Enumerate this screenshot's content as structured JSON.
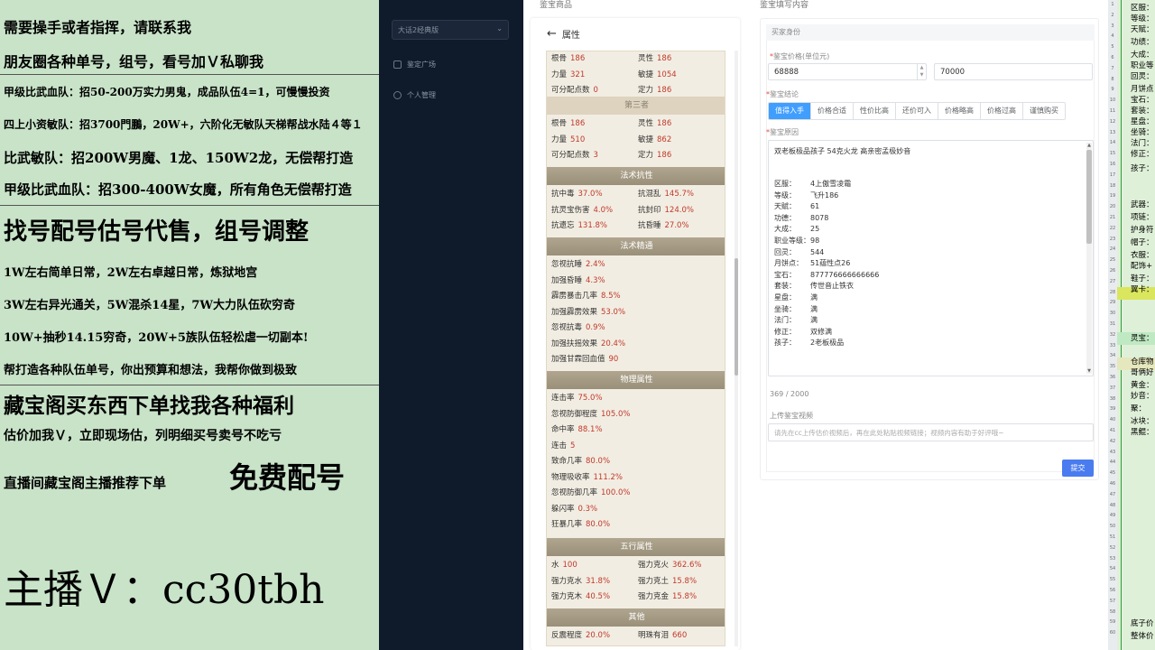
{
  "overlay": {
    "lines": [
      "需要操手或者指挥，请联系我",
      "朋友圈各种单号，组号，看号加Ｖ私聊我",
      "甲级比武血队：招50-200万实力男鬼，成品队伍4=1，可慢慢投资",
      "四上小资敏队：招3700門鵬，20W+，六阶化无敏队天梯帮战水陆４等１",
      "比武敏队：招200W男魔、1龙、150W2龙，无偿帮打造",
      "甲级比武血队：招300-400W女魔，所有角色无偿帮打造",
      "找号配号估号代售，组号调整",
      "1W左右简单日常，2W左右卓越日常，炼狱地宫",
      "3W左右异光通关，5W混杀14星，7W大力队伍砍穷奇",
      "10W+抽秒14.15穷奇，20W+5族队伍轻松虐一切副本!",
      "帮打造各种队伍单号，你出预算和想法，我帮你做到极致",
      "藏宝阁买东西下单找我各种福利",
      "估价加我Ｖ，立即现场估，列明细买号卖号不吃亏",
      "直播间藏宝阁主播推荐下单",
      "免费配号",
      "主播Ｖ：cc30tbh"
    ]
  },
  "appnav": {
    "select_value": "大话2经典版",
    "items": [
      "鉴定广场",
      "个人管理"
    ]
  },
  "main": {
    "left_title": "鉴宝商品",
    "right_title": "鉴宝填写内容",
    "attr_back_label": "属性",
    "blocks": [
      {
        "header": "",
        "rows": [
          {
            "k1": "根骨",
            "v1": "186",
            "k2": "灵性",
            "v2": "186"
          },
          {
            "k1": "力量",
            "v1": "321",
            "k2": "敏捷",
            "v2": "1054"
          },
          {
            "k1": "可分配点数",
            "v1": "0",
            "k2": "定力",
            "v2": "186"
          }
        ]
      },
      {
        "header": "第三者",
        "rows": [
          {
            "k1": "根骨",
            "v1": "186",
            "k2": "灵性",
            "v2": "186"
          },
          {
            "k1": "力量",
            "v1": "510",
            "k2": "敏捷",
            "v2": "862"
          },
          {
            "k1": "可分配点数",
            "v1": "3",
            "k2": "定力",
            "v2": "186"
          }
        ]
      },
      {
        "header": "法术抗性",
        "rows": [
          {
            "k1": "抗中毒",
            "v1": "37.0%",
            "k2": "抗混乱",
            "v2": "145.7%"
          },
          {
            "k1": "抗灵宝伤害",
            "v1": "4.0%",
            "k2": "抗封印",
            "v2": "124.0%"
          },
          {
            "k1": "抗遗忘",
            "v1": "131.8%",
            "k2": "抗昏睡",
            "v2": "27.0%"
          }
        ]
      },
      {
        "header": "法术精通",
        "rows": [
          {
            "k1": "忽视抗睡",
            "v1": "2.4%"
          },
          {
            "k1": "加强昏睡",
            "v1": "4.3%"
          },
          {
            "k1": "霹雳暴击几率",
            "v1": "8.5%"
          },
          {
            "k1": "加强霹雳效果",
            "v1": "53.0%"
          },
          {
            "k1": "忽视抗毒",
            "v1": "0.9%"
          },
          {
            "k1": "加强扶摇效果",
            "v1": "20.4%"
          },
          {
            "k1": "加强甘霖回血值",
            "v1": "90"
          }
        ]
      },
      {
        "header": "物理属性",
        "rows": [
          {
            "k1": "连击率",
            "v1": "75.0%"
          },
          {
            "k1": "忽视防御程度",
            "v1": "105.0%"
          },
          {
            "k1": "命中率",
            "v1": "88.1%"
          },
          {
            "k1": "连击",
            "v1": "5"
          },
          {
            "k1": "致命几率",
            "v1": "80.0%"
          },
          {
            "k1": "物理吸收率",
            "v1": "111.2%"
          },
          {
            "k1": "忽视防御几率",
            "v1": "100.0%"
          },
          {
            "k1": "躲闪率",
            "v1": "0.3%"
          },
          {
            "k1": "狂暴几率",
            "v1": "80.0%"
          }
        ]
      },
      {
        "header": "五行属性",
        "rows": [
          {
            "k1": "水",
            "v1": "100",
            "k2": "强力克火",
            "v2": "362.6%"
          },
          {
            "k1": "强力克水",
            "v1": "31.8%",
            "k2": "强力克土",
            "v2": "15.8%"
          },
          {
            "k1": "强力克木",
            "v1": "40.5%",
            "k2": "强力克金",
            "v2": "15.8%"
          }
        ]
      },
      {
        "header": "其他",
        "rows": [
          {
            "k1": "反震程度",
            "v1": "20.0%",
            "k2": "明珠有泪",
            "v2": "660"
          }
        ]
      }
    ]
  },
  "form": {
    "section_title": "买家身份",
    "price_label": "鉴宝价格(单位元)",
    "price_min": "68888",
    "price_max": "70000",
    "result_label": "鉴宝结论",
    "tabs": [
      "值得入手",
      "价格合适",
      "性价比高",
      "还价可入",
      "价格略高",
      "价格过高",
      "谨慎购买"
    ],
    "reason_label": "鉴宝原因",
    "reason_title": "双老板极品孩子 54克火龙 高亲密孟极妙音",
    "reason_rows": [
      {
        "k": "区服：",
        "v": "4上傲雪凌霜"
      },
      {
        "k": "等级：",
        "v": "飞升186"
      },
      {
        "k": "天赋：",
        "v": "61"
      },
      {
        "k": "功德：",
        "v": "8078"
      },
      {
        "k": "大成：",
        "v": "25"
      },
      {
        "k": "职业等级：",
        "v": "98"
      },
      {
        "k": "回灵：",
        "v": "544"
      },
      {
        "k": "月饼点：",
        "v": "51蕴性点26"
      },
      {
        "k": "宝石：",
        "v": "877776666666666"
      },
      {
        "k": "套装：",
        "v": "传世音止铁衣"
      },
      {
        "k": "星盘：",
        "v": "满"
      },
      {
        "k": "坐骑：",
        "v": "满"
      },
      {
        "k": "法门：",
        "v": "满"
      },
      {
        "k": "修正：",
        "v": "双修满"
      },
      {
        "k": "孩子：",
        "v": "2老板极品"
      }
    ],
    "counter": "369 / 2000",
    "video_label": "上传鉴宝视频",
    "video_placeholder": "请先在cc上传估价视频后，再在此处粘贴视频链接；视频内容有助于好评哦~",
    "submit_label": "提交"
  },
  "strip": {
    "labels": [
      "区服：",
      "等级：",
      "天赋：",
      "功绩：",
      "大成：",
      "职业等",
      "回灵：",
      "月饼点",
      "宝石：",
      "套装：",
      "星盘：",
      "坐骑：",
      "法门：",
      "修正：",
      "孩子：",
      "武器：",
      "项链：",
      "护身符",
      "帽子：",
      "衣服：",
      "配饰+",
      "鞋子：",
      "翼卡：",
      "灵宝：",
      "仓库物",
      "哥俩好",
      "黄金：",
      "妙音：",
      "聚：",
      "冰块：",
      "黑鲲：",
      "底子价",
      "整体价"
    ],
    "numbers": [
      "1",
      "2",
      "3",
      "4",
      "5",
      "6",
      "7",
      "8",
      "9",
      "10",
      "11",
      "12",
      "13",
      "14",
      "15",
      "16",
      "17",
      "18",
      "19",
      "20",
      "21",
      "22",
      "23",
      "24",
      "25",
      "26",
      "27",
      "28",
      "29",
      "30",
      "31",
      "32",
      "33",
      "34",
      "35",
      "36",
      "37",
      "38",
      "39",
      "40",
      "41",
      "42",
      "43",
      "44",
      "45",
      "46",
      "47",
      "48",
      "49",
      "50",
      "51",
      "52",
      "53",
      "54",
      "55",
      "56",
      "57",
      "58",
      "59",
      "60"
    ]
  }
}
